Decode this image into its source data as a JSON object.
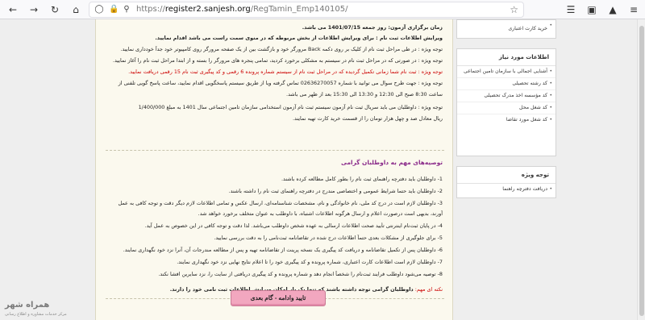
{
  "browser": {
    "url_prefix": "https://",
    "url_domain": "register2.sanjesh.org",
    "url_path": "/RegTamin_Emp140105/"
  },
  "content": {
    "lines": [
      {
        "text": "زمان برگزاری آزمون: روز جمعه 1401/07/15 می باشد.",
        "class": "bold"
      },
      {
        "text": "ویرایش اطلاعات ثبت نام : برای ویرایش اطلاعات از بخش مربوطه که در منوی سمت راست می باشد اقدام نمایید.",
        "class": "bold"
      },
      {
        "text": "توجه ویژه : در طی مراحل ثبت نام از کلیک بر روی دکمه Back مرورگر خود و بازگشت بین از یک صفحه مرورگر روی کامپیوتر خود جداً خودداری نمایید.",
        "class": ""
      },
      {
        "text": "توجه ویژه : در صورتی که در مراحل ثبت نام در سیستم به مشکلی برخورد کردید، تمامی پنجره های مرورگر را بسته و از ابتدا مراحل ثبت نام را آغاز نمایید.",
        "class": ""
      },
      {
        "text": "توجه ویژه : ثبت نام شما زمانی تکمیل گردیده که در مراحل ثبت نام از سیستم شماره پرونده 6 رقمی و کد پیگیری ثبت نام 15 رقمی دریافت نمایید.",
        "class": "red"
      },
      {
        "text": "توجه ویژه : جهت طرح سوال می توانید با شماره 02636270057 تماس گرفته ویا از طریق سیستم پاسخگویی اقدام نمایید، ساعت پاسخ گویی تلفنی از",
        "class": ""
      },
      {
        "text": "ساعت 8:30 صبح الی 12:30 و 13:30 الی 15:30 بعد از ظهر می باشد.",
        "class": ""
      },
      {
        "text": "توجه ویژه : داوطلبان می باید سریال ثبت نام آزمون سیستم ثبت نام آزمون استخدامی سازمان تامین اجتماعی سال 1401 به مبلغ 1/400/000",
        "class": ""
      },
      {
        "text": "ریال معادل صد و چهل هزار تومان را از قسمت خرید کارت تهیه نمایند.",
        "class": ""
      }
    ],
    "section_title": "توصیه‌های مهم به داوطلبان گرامی",
    "recommendations": [
      "1- داوطلبان باید دفترچه راهنمای ثبت نام را بطور کامل مطالعه کرده باشند.",
      "2- داوطلبان باید حتما شرایط عمومی و اختصاصی مندرج در دفترچه راهنمای ثبت نام را داشته باشند.",
      "3- داوطلبان لازم است در درج کد ملی، نام خانوادگی و نام، مشخصات شناسنامه‌ای، ارسال عکس و تمامی اطلاعات لازم دیگر دقت و توجه کافی به عمل",
      "آورند، بدیهی است درصورت اعلام و ارسال هرگونه اطلاعات اشتباه، با داوطلب به عنوان متخلف برخورد خواهد شد.",
      "4- در پایان ثبت‌نام اینترنتی تأیید صحت اطلاعات ارسالی به عهده شخص داوطلب می‌باشد. لذا دقت و توجه کافی در این خصوص به عمل آید.",
      "5- برای جلوگیری از مشکلات بعدی حتماً اطلاعات درج شده در تقاضانامه ثبت‌نامی را به دقت بررسی نمایید.",
      "6- داوطلبان پس از تکمیل تقاضانامه و دریافت کد پیگیری یک نسخه پرینت از تقاضانامه تهیه و پس از مطالعه مندرجات آن، آنرا نزد خود نگهداری نمایند.",
      "7- داوطلبان لازم است اطلاعات کارت اعتباری، شماره پرونده و کد پیگیری خود را تا اعلام نتایج نهایی نزد خود نگهداری نمایند.",
      "8- توصیه می‌شود داوطلب فرایند ثبت‌نام را شخصاً انجام دهد و شماره پرونده و کد پیگیری دریافتی از سایت را، نزد سایرین افشا نکند."
    ],
    "note_label": "نکته ای مهم:",
    "note_text": "داوطلبان گرامی توجه داشته باشند که تنها یک بار امکان ویرایش اطلاعات ثبت نامی خود را دارند.",
    "next_button": "تایید وادامه - گام بعدی"
  },
  "logo": {
    "text": "همراه شهر",
    "sub": "مرکز خدمات مشاوره و اطلاع رسانی"
  },
  "sidebar": {
    "top_box_items": [
      "خرید کارت اعتباری"
    ],
    "info_box_title": "اطلاعات مورد نیاز",
    "info_items": [
      "آشنایی اجمالی با سازمان تامین اجتماعی",
      "کد رشته تحصیلی",
      "کد مؤسسه اخذ مدرک تحصیلی",
      "کد شغل محل",
      "کد شغل مورد تقاضا"
    ],
    "special_box_title": "توجه ویژه",
    "special_items": [
      "دریافت دفترچه راهنما"
    ]
  }
}
